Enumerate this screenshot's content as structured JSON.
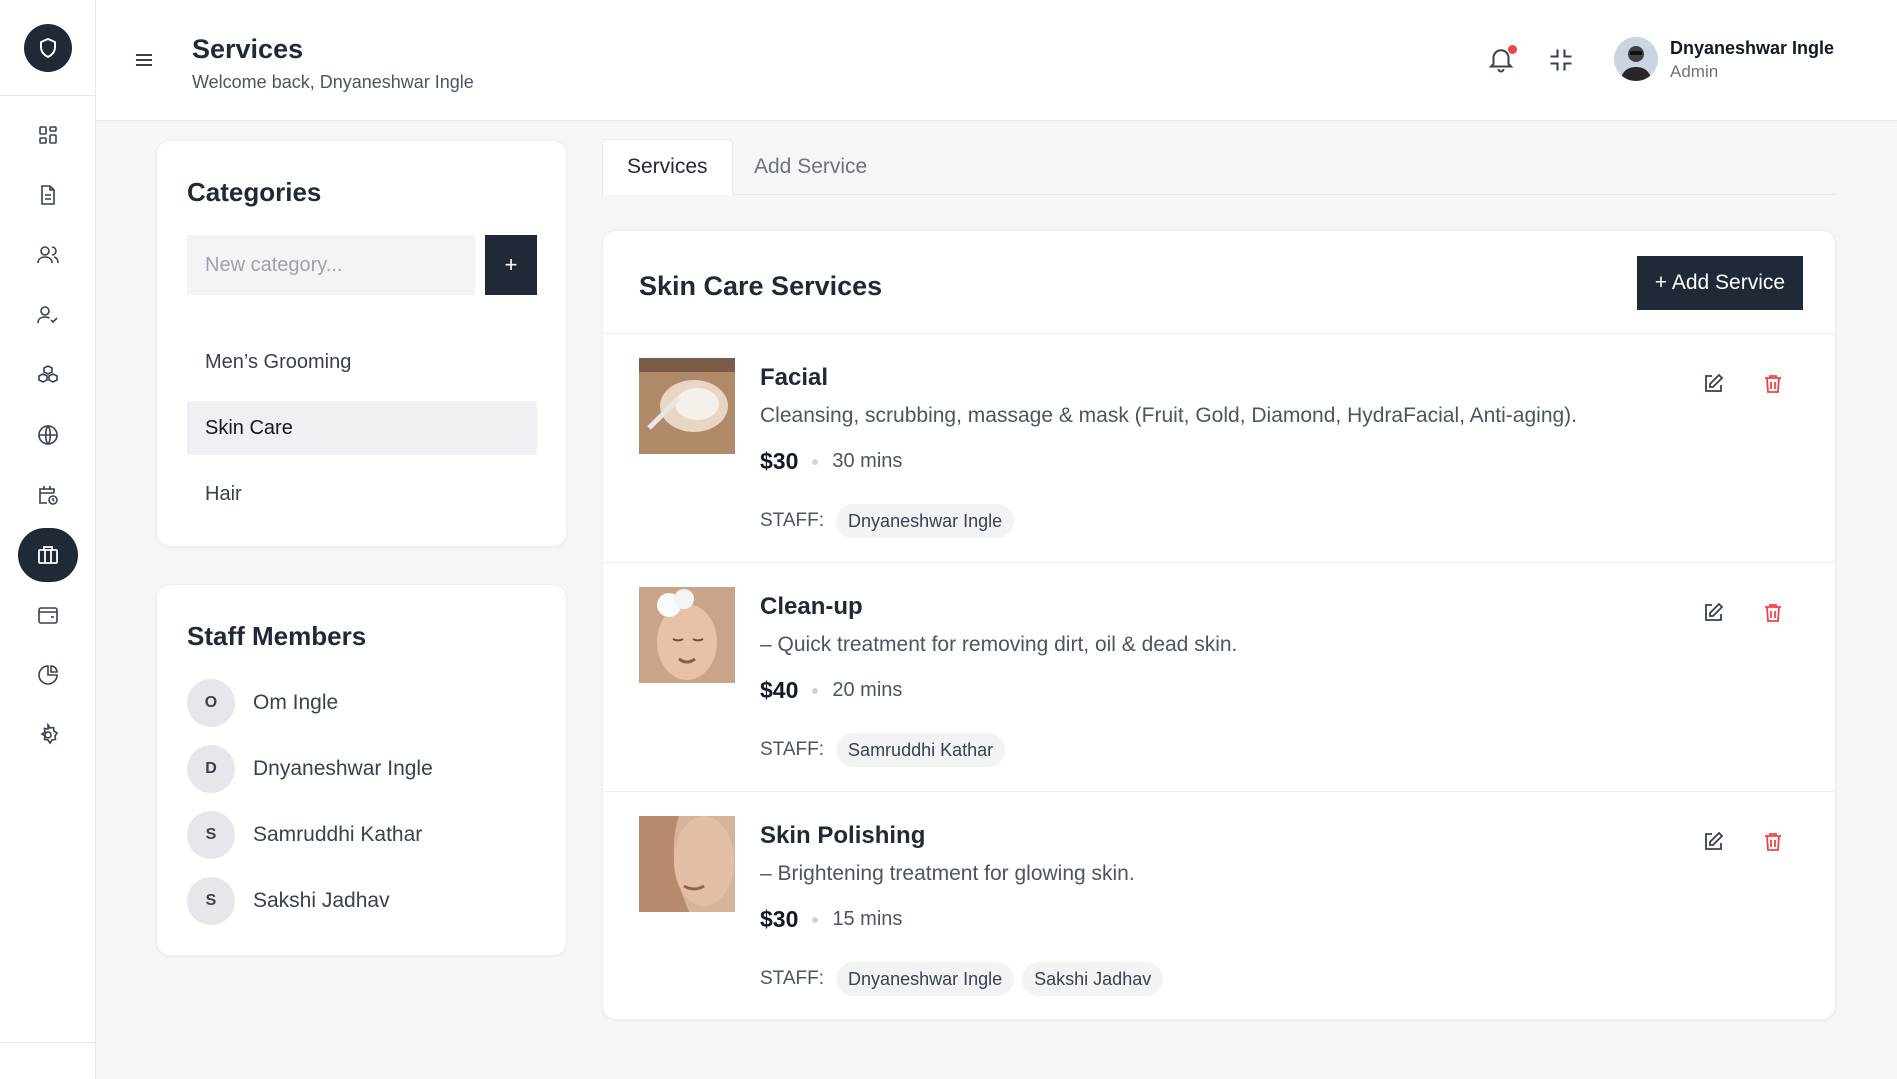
{
  "header": {
    "title": "Services",
    "subtitle": "Welcome back, Dnyaneshwar Ingle",
    "user_name": "Dnyaneshwar Ingle",
    "user_role": "Admin"
  },
  "sidebar": {
    "items": [
      {
        "icon": "dashboard-icon"
      },
      {
        "icon": "document-icon"
      },
      {
        "icon": "users-icon"
      },
      {
        "icon": "user-check-icon"
      },
      {
        "icon": "cubes-icon"
      },
      {
        "icon": "globe-icon"
      },
      {
        "icon": "calendar-clock-icon"
      },
      {
        "icon": "briefcase-icon",
        "active": true
      },
      {
        "icon": "wallet-icon"
      },
      {
        "icon": "pie-chart-icon"
      },
      {
        "icon": "settings-icon"
      }
    ]
  },
  "categories": {
    "heading": "Categories",
    "input_placeholder": "New category...",
    "add_label": "+",
    "items": [
      "Men’s Grooming",
      "Skin Care",
      "Hair"
    ],
    "selected": "Skin Care"
  },
  "staff": {
    "heading": "Staff Members",
    "members": [
      {
        "initial": "O",
        "name": "Om Ingle"
      },
      {
        "initial": "D",
        "name": "Dnyaneshwar Ingle"
      },
      {
        "initial": "S",
        "name": "Samruddhi Kathar"
      },
      {
        "initial": "S",
        "name": "Sakshi Jadhav"
      }
    ]
  },
  "tabs": {
    "services": "Services",
    "add_service": "Add Service"
  },
  "services": {
    "title": "Skin Care Services",
    "add_button": "+ Add Service",
    "staff_label": "STAFF:",
    "items": [
      {
        "name": "Facial",
        "description": "Cleansing, scrubbing, massage & mask (Fruit, Gold, Diamond, HydraFacial, Anti-aging).",
        "price": "$30",
        "duration": "30 mins",
        "staff": [
          "Dnyaneshwar Ingle"
        ]
      },
      {
        "name": "Clean-up",
        "description": "– Quick treatment for removing dirt, oil & dead skin.",
        "price": "$40",
        "duration": "20 mins",
        "staff": [
          "Samruddhi Kathar"
        ]
      },
      {
        "name": "Skin Polishing",
        "description": "– Brightening treatment for glowing skin.",
        "price": "$30",
        "duration": "15 mins",
        "staff": [
          "Dnyaneshwar Ingle",
          "Sakshi Jadhav"
        ]
      }
    ]
  },
  "colors": {
    "primary_dark": "#1f2937",
    "danger": "#ef4444",
    "background": "#f5f6f8"
  }
}
